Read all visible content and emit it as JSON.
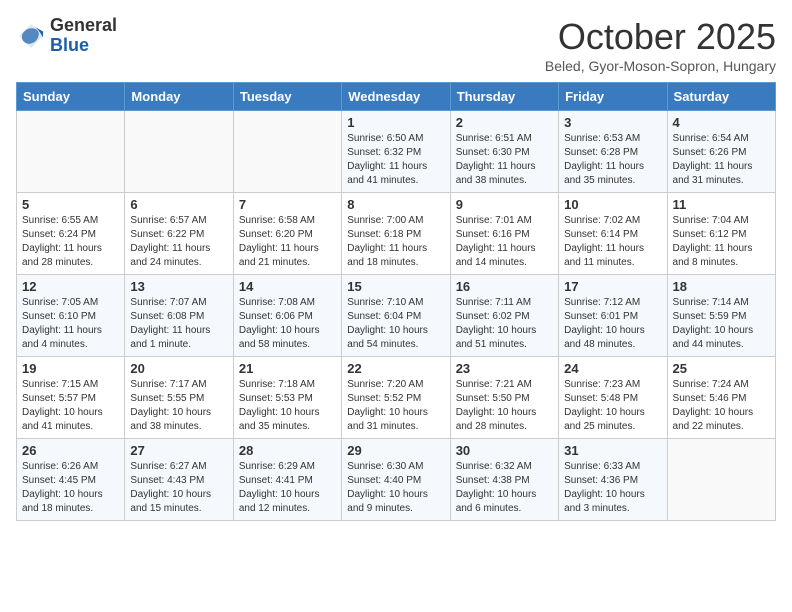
{
  "header": {
    "logo_general": "General",
    "logo_blue": "Blue",
    "month_title": "October 2025",
    "subtitle": "Beled, Gyor-Moson-Sopron, Hungary"
  },
  "weekdays": [
    "Sunday",
    "Monday",
    "Tuesday",
    "Wednesday",
    "Thursday",
    "Friday",
    "Saturday"
  ],
  "weeks": [
    [
      {
        "day": "",
        "info": ""
      },
      {
        "day": "",
        "info": ""
      },
      {
        "day": "",
        "info": ""
      },
      {
        "day": "1",
        "info": "Sunrise: 6:50 AM\nSunset: 6:32 PM\nDaylight: 11 hours\nand 41 minutes."
      },
      {
        "day": "2",
        "info": "Sunrise: 6:51 AM\nSunset: 6:30 PM\nDaylight: 11 hours\nand 38 minutes."
      },
      {
        "day": "3",
        "info": "Sunrise: 6:53 AM\nSunset: 6:28 PM\nDaylight: 11 hours\nand 35 minutes."
      },
      {
        "day": "4",
        "info": "Sunrise: 6:54 AM\nSunset: 6:26 PM\nDaylight: 11 hours\nand 31 minutes."
      }
    ],
    [
      {
        "day": "5",
        "info": "Sunrise: 6:55 AM\nSunset: 6:24 PM\nDaylight: 11 hours\nand 28 minutes."
      },
      {
        "day": "6",
        "info": "Sunrise: 6:57 AM\nSunset: 6:22 PM\nDaylight: 11 hours\nand 24 minutes."
      },
      {
        "day": "7",
        "info": "Sunrise: 6:58 AM\nSunset: 6:20 PM\nDaylight: 11 hours\nand 21 minutes."
      },
      {
        "day": "8",
        "info": "Sunrise: 7:00 AM\nSunset: 6:18 PM\nDaylight: 11 hours\nand 18 minutes."
      },
      {
        "day": "9",
        "info": "Sunrise: 7:01 AM\nSunset: 6:16 PM\nDaylight: 11 hours\nand 14 minutes."
      },
      {
        "day": "10",
        "info": "Sunrise: 7:02 AM\nSunset: 6:14 PM\nDaylight: 11 hours\nand 11 minutes."
      },
      {
        "day": "11",
        "info": "Sunrise: 7:04 AM\nSunset: 6:12 PM\nDaylight: 11 hours\nand 8 minutes."
      }
    ],
    [
      {
        "day": "12",
        "info": "Sunrise: 7:05 AM\nSunset: 6:10 PM\nDaylight: 11 hours\nand 4 minutes."
      },
      {
        "day": "13",
        "info": "Sunrise: 7:07 AM\nSunset: 6:08 PM\nDaylight: 11 hours\nand 1 minute."
      },
      {
        "day": "14",
        "info": "Sunrise: 7:08 AM\nSunset: 6:06 PM\nDaylight: 10 hours\nand 58 minutes."
      },
      {
        "day": "15",
        "info": "Sunrise: 7:10 AM\nSunset: 6:04 PM\nDaylight: 10 hours\nand 54 minutes."
      },
      {
        "day": "16",
        "info": "Sunrise: 7:11 AM\nSunset: 6:02 PM\nDaylight: 10 hours\nand 51 minutes."
      },
      {
        "day": "17",
        "info": "Sunrise: 7:12 AM\nSunset: 6:01 PM\nDaylight: 10 hours\nand 48 minutes."
      },
      {
        "day": "18",
        "info": "Sunrise: 7:14 AM\nSunset: 5:59 PM\nDaylight: 10 hours\nand 44 minutes."
      }
    ],
    [
      {
        "day": "19",
        "info": "Sunrise: 7:15 AM\nSunset: 5:57 PM\nDaylight: 10 hours\nand 41 minutes."
      },
      {
        "day": "20",
        "info": "Sunrise: 7:17 AM\nSunset: 5:55 PM\nDaylight: 10 hours\nand 38 minutes."
      },
      {
        "day": "21",
        "info": "Sunrise: 7:18 AM\nSunset: 5:53 PM\nDaylight: 10 hours\nand 35 minutes."
      },
      {
        "day": "22",
        "info": "Sunrise: 7:20 AM\nSunset: 5:52 PM\nDaylight: 10 hours\nand 31 minutes."
      },
      {
        "day": "23",
        "info": "Sunrise: 7:21 AM\nSunset: 5:50 PM\nDaylight: 10 hours\nand 28 minutes."
      },
      {
        "day": "24",
        "info": "Sunrise: 7:23 AM\nSunset: 5:48 PM\nDaylight: 10 hours\nand 25 minutes."
      },
      {
        "day": "25",
        "info": "Sunrise: 7:24 AM\nSunset: 5:46 PM\nDaylight: 10 hours\nand 22 minutes."
      }
    ],
    [
      {
        "day": "26",
        "info": "Sunrise: 6:26 AM\nSunset: 4:45 PM\nDaylight: 10 hours\nand 18 minutes."
      },
      {
        "day": "27",
        "info": "Sunrise: 6:27 AM\nSunset: 4:43 PM\nDaylight: 10 hours\nand 15 minutes."
      },
      {
        "day": "28",
        "info": "Sunrise: 6:29 AM\nSunset: 4:41 PM\nDaylight: 10 hours\nand 12 minutes."
      },
      {
        "day": "29",
        "info": "Sunrise: 6:30 AM\nSunset: 4:40 PM\nDaylight: 10 hours\nand 9 minutes."
      },
      {
        "day": "30",
        "info": "Sunrise: 6:32 AM\nSunset: 4:38 PM\nDaylight: 10 hours\nand 6 minutes."
      },
      {
        "day": "31",
        "info": "Sunrise: 6:33 AM\nSunset: 4:36 PM\nDaylight: 10 hours\nand 3 minutes."
      },
      {
        "day": "",
        "info": ""
      }
    ]
  ]
}
